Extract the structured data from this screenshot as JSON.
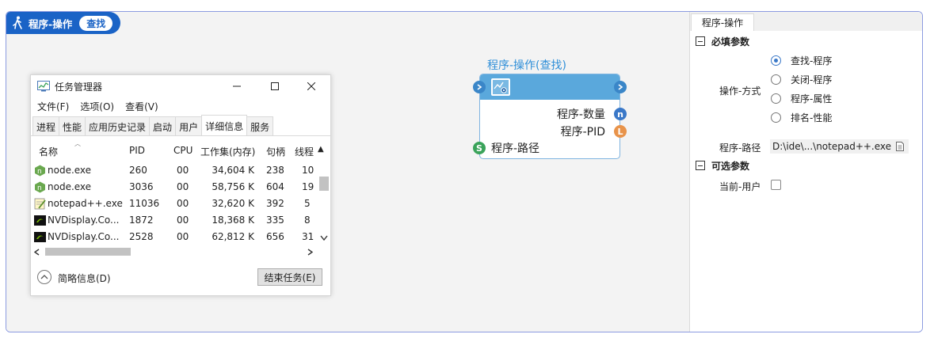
{
  "header": {
    "title": "程序-操作",
    "badge": "查找"
  },
  "task_manager": {
    "title": "任务管理器",
    "menu": [
      "文件(F)",
      "选项(O)",
      "查看(V)"
    ],
    "tabs": [
      "进程",
      "性能",
      "应用历史记录",
      "启动",
      "用户",
      "详细信息",
      "服务"
    ],
    "active_tab": "详细信息",
    "columns": [
      "名称",
      "PID",
      "CPU",
      "工作集(内存)",
      "句柄",
      "线程"
    ],
    "rows": [
      {
        "icon": "node-icon",
        "name": "node.exe",
        "pid": "260",
        "cpu": "00",
        "mem": "34,604 K",
        "handles": "238",
        "threads": "10"
      },
      {
        "icon": "node-icon",
        "name": "node.exe",
        "pid": "3036",
        "cpu": "00",
        "mem": "58,756 K",
        "handles": "604",
        "threads": "19"
      },
      {
        "icon": "notepad-icon",
        "name": "notepad++.exe",
        "pid": "11036",
        "cpu": "00",
        "mem": "32,620 K",
        "handles": "392",
        "threads": "5"
      },
      {
        "icon": "nvidia-icon",
        "name": "NVDisplay.Co...",
        "pid": "1872",
        "cpu": "00",
        "mem": "18,368 K",
        "handles": "335",
        "threads": "8"
      },
      {
        "icon": "nvidia-icon",
        "name": "NVDisplay.Co...",
        "pid": "2528",
        "cpu": "00",
        "mem": "62,812 K",
        "handles": "656",
        "threads": "31"
      }
    ],
    "brief_label": "简略信息(D)",
    "end_task_label": "结束任务(E)"
  },
  "node": {
    "title": "程序-操作(查找)",
    "outputs": [
      {
        "label": "程序-数量",
        "port": "n"
      },
      {
        "label": "程序-PID",
        "port": "L"
      }
    ],
    "inputs": [
      {
        "label": "程序-路径",
        "port": "S"
      }
    ],
    "colors": {
      "head": "#5aa8dc",
      "port_n": "#3a78c8",
      "port_L": "#e8934a",
      "port_S": "#3aa35a"
    }
  },
  "panel": {
    "tab": "程序-操作",
    "required_label": "必填参数",
    "operation_label": "操作-方式",
    "options": [
      "查找-程序",
      "关闭-程序",
      "程序-属性",
      "排名-性能"
    ],
    "selected_option": "查找-程序",
    "path_label": "程序-路径",
    "path_value": "D:\\ide\\...\\notepad++.exe",
    "optional_label": "可选参数",
    "user_label": "当前-用户",
    "user_checked": false
  },
  "colors": {
    "accent": "#1a63c6",
    "border": "#8c9be0"
  }
}
